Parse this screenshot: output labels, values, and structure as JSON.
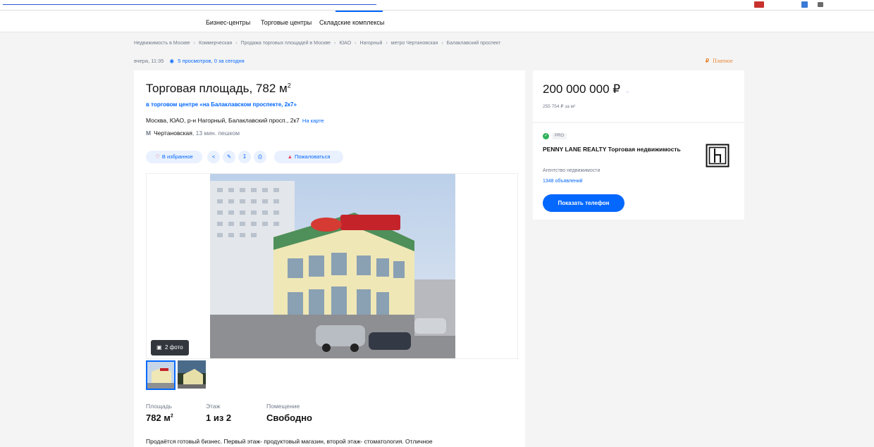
{
  "subnav": {
    "tabs": [
      {
        "label": "Бизнес-центры"
      },
      {
        "label": "Торговые центры"
      },
      {
        "label": "Складские комплексы"
      }
    ]
  },
  "breadcrumbs": [
    "Недвижимость в Москве",
    "Коммерческая",
    "Продажа торговых площадей в Москве",
    "ЮАО",
    "Нагорный",
    "метро Чертановская",
    "Балаклавский проспект"
  ],
  "meta": {
    "date": "вчера, 11:35",
    "views": "5 просмотров, 0 за сегодня",
    "paid_label": "Платное"
  },
  "listing": {
    "title": "Торговая площадь, 782 м",
    "title_sup": "2",
    "tc_link": "в торговом центре «на Балаклавском проспекте, 2к7»",
    "address": "Москва, ЮАО, р-н Нагорный, Балаклавский просп., 2к7",
    "map_link": "На карте",
    "metro_station": "Чертановская",
    "metro_time": ", 13 мин. пешком"
  },
  "actions": {
    "favorite": "В избранное",
    "complain": "Пожаловаться"
  },
  "gallery": {
    "photo_count": "2 фото"
  },
  "specs": [
    {
      "label": "Площадь",
      "value": "782 м",
      "sup": "2"
    },
    {
      "label": "Этаж",
      "value": "1 из 2",
      "sup": ""
    },
    {
      "label": "Помещение",
      "value": "Свободно",
      "sup": ""
    }
  ],
  "description": "Продаётся готовый бизнес. Первый этаж- продуктовый магазин, второй этаж- стоматология. Отличное",
  "price": {
    "value": "200 000 000 ₽",
    "per_m": "255 754 ₽ за м²"
  },
  "agent": {
    "badge": "PRO",
    "name": "PENNY LANE REALTY Торговая недвижимость",
    "type": "Агентство недвижимости",
    "listings": "1348 объявлений",
    "show_phone": "Показать телефон"
  },
  "colors": {
    "accent": "#0468ff",
    "paid": "#e6822e",
    "favorite": "#e84260",
    "pro_check": "#2fb159"
  }
}
